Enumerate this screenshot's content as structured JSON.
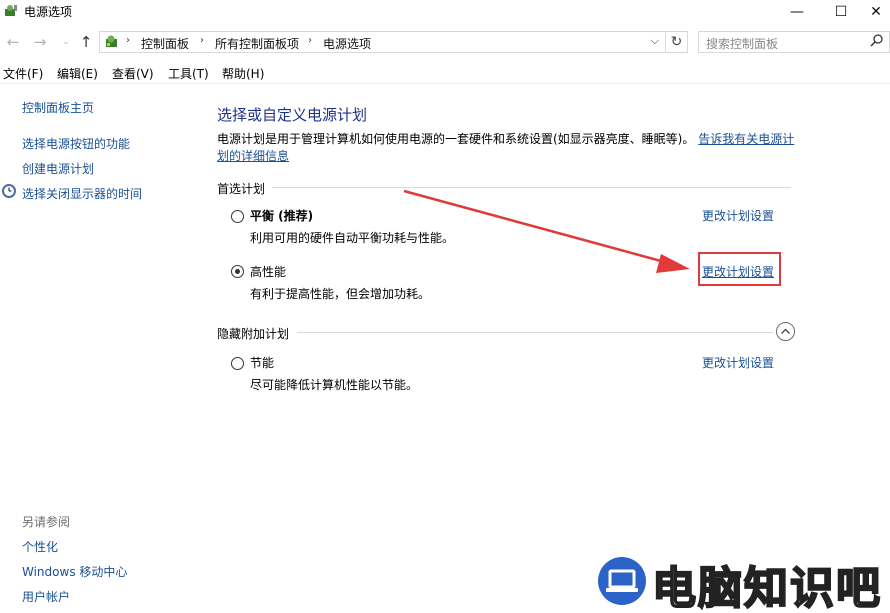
{
  "window": {
    "title": "电源选项",
    "min_glyph": "—",
    "max_glyph": "☐",
    "close_glyph": "✕"
  },
  "nav": {
    "back_glyph": "←",
    "forward_glyph": "→",
    "recent_glyph": "⌄",
    "up_glyph": "↑",
    "breadcrumbs": [
      "控制面板",
      "所有控制面板项",
      "电源选项"
    ],
    "separator": "›",
    "dropdown_glyph": "⌵",
    "refresh_glyph": "↻",
    "search_placeholder": "搜索控制面板"
  },
  "menu": [
    "文件(F)",
    "编辑(E)",
    "查看(V)",
    "工具(T)",
    "帮助(H)"
  ],
  "sidebar": {
    "home": "控制面板主页",
    "links": [
      "选择电源按钮的功能",
      "创建电源计划",
      "选择关闭显示器的时间"
    ],
    "see_also_title": "另请参阅",
    "see_also": [
      "个性化",
      "Windows 移动中心",
      "用户帐户"
    ]
  },
  "main": {
    "heading": "选择或自定义电源计划",
    "description": "电源计划是用于管理计算机如何使用电源的一套硬件和系统设置(如显示器亮度、睡眠等)。",
    "description_link": "告诉我有关电源计划的详细信息",
    "preferred_label": "首选计划",
    "hidden_label": "隐藏附加计划",
    "plans": [
      {
        "name": "平衡 (推荐)",
        "desc": "利用可用的硬件自动平衡功耗与性能。",
        "link": "更改计划设置",
        "selected": false
      },
      {
        "name": "高性能",
        "desc": "有利于提高性能，但会增加功耗。",
        "link": "更改计划设置",
        "selected": true
      },
      {
        "name": "节能",
        "desc": "尽可能降低计算机性能以节能。",
        "link": "更改计划设置",
        "selected": false
      }
    ]
  },
  "watermark": {
    "text": "电脑知识吧"
  },
  "colors": {
    "link": "#1a5096",
    "heading": "#1e3287",
    "annotation_red": "#e03a3a",
    "watermark_blue": "#2b63c8"
  }
}
